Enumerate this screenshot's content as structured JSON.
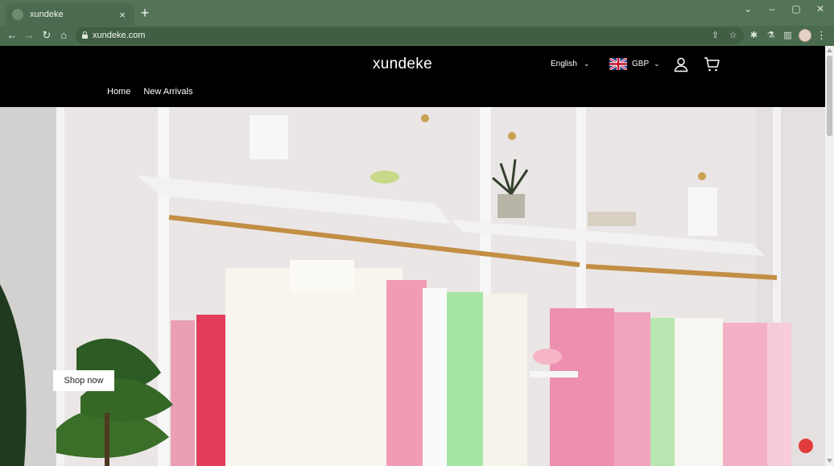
{
  "browser": {
    "tab": {
      "title": "xundeke",
      "favicon": "globe-icon",
      "close_icon": "close-icon"
    },
    "new_tab_icon": "plus-icon",
    "window_controls": [
      "chevron-down-icon",
      "minimize-icon",
      "maximize-icon",
      "close-icon"
    ],
    "url": "xundeke.com",
    "nav_icons": [
      "back-icon",
      "forward-icon",
      "reload-icon",
      "home-icon"
    ],
    "omnibox_icons": [
      "share-icon",
      "star-icon"
    ],
    "toolbar_icons": [
      "extensions-icon",
      "labs-icon",
      "sidepanel-icon",
      "profile-avatar",
      "kebab-menu-icon"
    ]
  },
  "site": {
    "logo": "xundeke",
    "language": "English",
    "currency": "GBP",
    "nav": [
      {
        "label": "Home"
      },
      {
        "label": "New Arrivals"
      }
    ],
    "hero": {
      "cta_label": "Shop now",
      "image": "boutique clothing rack with pink, green and white garments"
    }
  },
  "colors": {
    "chrome": "#547458",
    "header_bg": "#000000",
    "header_text": "#ffffff",
    "chat_button": "#e23b3b"
  }
}
